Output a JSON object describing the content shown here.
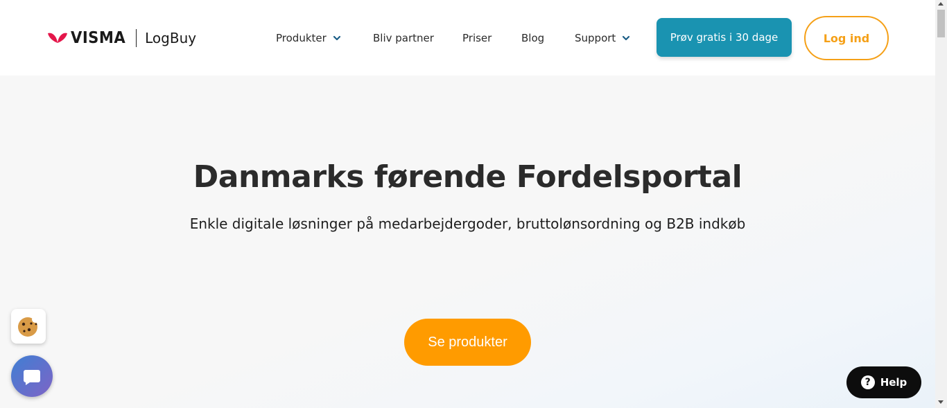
{
  "header": {
    "logo_brand": "VISMA",
    "logo_product": "LogBuy",
    "nav": [
      {
        "label": "Produkter",
        "has_dropdown": true,
        "icon": "chevron-down-icon"
      },
      {
        "label": "Bliv partner",
        "has_dropdown": false
      },
      {
        "label": "Priser",
        "has_dropdown": false
      },
      {
        "label": "Blog",
        "has_dropdown": false
      },
      {
        "label": "Support",
        "has_dropdown": true,
        "icon": "chevron-down-icon"
      }
    ],
    "trial_button": "Prøv gratis i 30 dage",
    "login_button": "Log ind"
  },
  "hero": {
    "title": "Danmarks førende Fordelsportal",
    "subtitle": "Enkle digitale løsninger på medarbejdergoder, bruttolønsordning og B2B indkøb",
    "cta_button": "Se produkter"
  },
  "widgets": {
    "cookie_icon": "cookie-icon",
    "chat_icon": "chat-bubble-icon",
    "help_label": "Help",
    "help_icon": "question-circle-icon"
  },
  "colors": {
    "visma_red": "#e4164a",
    "trial_teal": "#1a93b1",
    "login_orange": "#f5a017",
    "cta_orange": "#ff9b00",
    "help_black": "#0d0d0d"
  }
}
